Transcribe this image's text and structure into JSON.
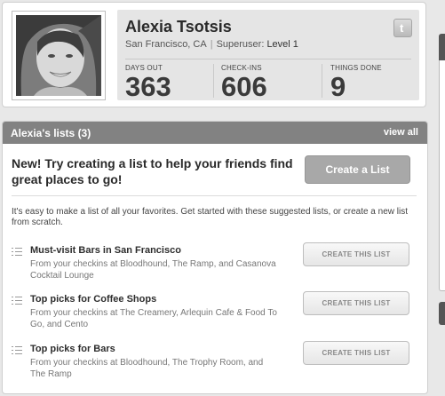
{
  "profile": {
    "name": "Alexia Tsotsis",
    "location": "San Francisco, CA",
    "superuser_label": "Superuser:",
    "superuser_level": "Level 1",
    "twitter_icon": "twitter-icon",
    "stats": [
      {
        "label": "DAYS OUT",
        "value": "363"
      },
      {
        "label": "CHECK-INS",
        "value": "606"
      },
      {
        "label": "THINGS DONE",
        "value": "9"
      }
    ]
  },
  "lists": {
    "title": "Alexia's lists (3)",
    "view_all": "view all",
    "promo": "New! Try creating a list to help your friends find great places to go!",
    "create_button": "Create a List",
    "intro": "It's easy to make a list of all your favorites. Get started with these suggested lists, or create a new list from scratch.",
    "suggestions": [
      {
        "title": "Must-visit Bars in San Francisco",
        "description": "From your checkins at Bloodhound, The Ramp, and Casanova Cocktail Lounge",
        "button": "CREATE THIS LIST"
      },
      {
        "title": "Top picks for Coffee Shops",
        "description": "From your checkins at The Creamery, Arlequin Cafe & Food To Go, and Cento",
        "button": "CREATE THIS LIST"
      },
      {
        "title": "Top picks for Bars",
        "description": "From your checkins at Bloodhound, The Trophy Room, and The Ramp",
        "button": "CREATE THIS LIST"
      }
    ]
  },
  "colors": {
    "header_bg": "#828282",
    "create_button_bg": "#a8a8a8",
    "stats_panel_bg": "#e5e5e5"
  }
}
